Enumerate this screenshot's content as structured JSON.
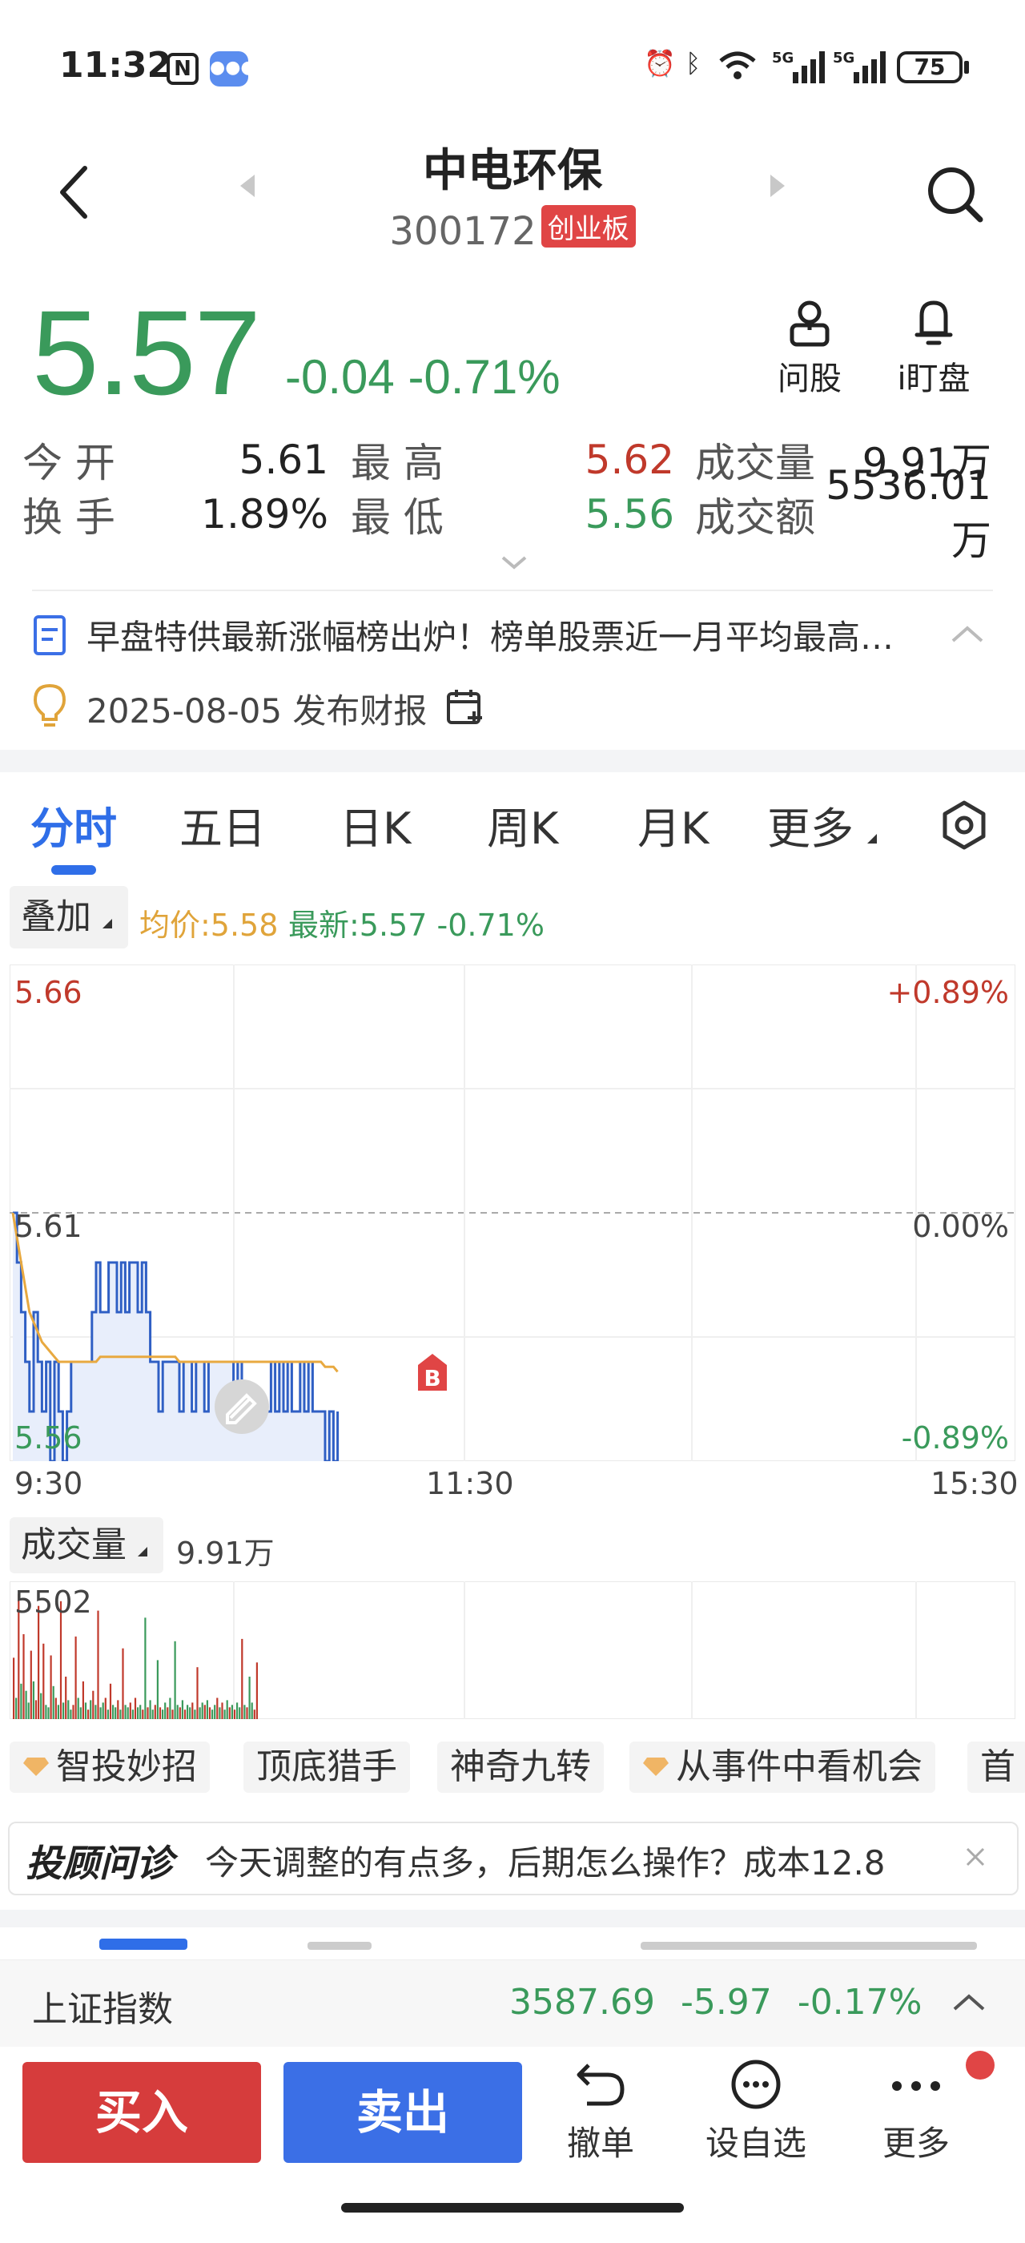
{
  "status_bar": {
    "time": "11:32",
    "nfc": "N",
    "battery": "75"
  },
  "header": {
    "title": "中电环保",
    "code": "300172",
    "board": "创业板"
  },
  "quote": {
    "price": "5.57",
    "change": "-0.04",
    "change_pct": "-0.71%",
    "tools": {
      "ask": "问股",
      "watch": "i盯盘"
    }
  },
  "stats": {
    "row1": [
      {
        "label": "今 开",
        "value": "5.61"
      },
      {
        "label": "最 高",
        "value": "5.62"
      },
      {
        "label": "成交量",
        "value": "9.91万"
      }
    ],
    "row2": [
      {
        "label": "换 手",
        "value": "1.89%"
      },
      {
        "label": "最 低",
        "value": "5.56"
      },
      {
        "label": "成交额",
        "value": "5536.01万"
      }
    ]
  },
  "news": {
    "text": "早盘特供最新涨幅榜出炉！榜单股票近一月平均最高…"
  },
  "event": {
    "text": "2025-08-05 发布财报"
  },
  "tabs": [
    {
      "label": "分时"
    },
    {
      "label": "五日"
    },
    {
      "label": "日K"
    },
    {
      "label": "周K"
    },
    {
      "label": "月K"
    },
    {
      "label": "更多"
    }
  ],
  "overlay": {
    "label": "叠加",
    "avg": "均价:5.58",
    "latest": "最新:5.57 -0.71%"
  },
  "chart_data": {
    "type": "line",
    "title": "",
    "x_ticks": [
      "9:30",
      "11:30",
      "15:30"
    ],
    "y_left_ticks": [
      "5.66",
      "5.61",
      "5.56"
    ],
    "y_right_ticks": [
      "+0.89%",
      "0.00%",
      "-0.89%"
    ],
    "ylim": [
      5.56,
      5.66
    ],
    "prev_close": 5.61,
    "series": [
      {
        "name": "最新",
        "values": [
          5.61,
          5.6,
          5.59,
          5.58,
          5.57,
          5.59,
          5.58,
          5.57,
          5.58,
          5.56,
          5.58,
          5.57,
          5.56,
          5.57,
          5.58,
          5.58,
          5.58,
          5.58,
          5.58,
          5.59,
          5.6,
          5.59,
          5.59,
          5.6,
          5.6,
          5.59,
          5.6,
          5.59,
          5.6,
          5.6,
          5.59,
          5.6,
          5.59,
          5.58,
          5.58,
          5.57,
          5.58,
          5.58,
          5.58,
          5.58,
          5.57,
          5.58,
          5.58,
          5.57,
          5.58,
          5.58,
          5.57,
          5.58,
          5.58,
          5.58,
          5.58,
          5.58,
          5.58,
          5.57,
          5.58,
          5.57,
          5.57,
          5.57,
          5.57,
          5.57,
          5.57,
          5.57,
          5.58,
          5.57,
          5.58,
          5.57,
          5.58,
          5.57,
          5.57,
          5.58,
          5.57,
          5.58,
          5.57,
          5.57,
          5.57,
          5.56,
          5.57,
          5.56,
          5.57
        ]
      },
      {
        "name": "均价",
        "values": [
          5.61,
          5.605,
          5.6,
          5.595,
          5.59,
          5.588,
          5.586,
          5.584,
          5.583,
          5.582,
          5.581,
          5.58,
          5.58,
          5.58,
          5.58,
          5.58,
          5.58,
          5.58,
          5.58,
          5.58,
          5.58,
          5.581,
          5.581,
          5.581,
          5.581,
          5.581,
          5.581,
          5.581,
          5.581,
          5.581,
          5.581,
          5.581,
          5.581,
          5.581,
          5.581,
          5.581,
          5.581,
          5.581,
          5.581,
          5.581,
          5.58,
          5.58,
          5.58,
          5.58,
          5.58,
          5.58,
          5.58,
          5.58,
          5.58,
          5.58,
          5.58,
          5.58,
          5.58,
          5.58,
          5.58,
          5.58,
          5.58,
          5.58,
          5.58,
          5.58,
          5.58,
          5.58,
          5.58,
          5.58,
          5.58,
          5.58,
          5.58,
          5.58,
          5.58,
          5.58,
          5.58,
          5.58,
          5.58,
          5.58,
          5.58,
          5.579,
          5.579,
          5.579,
          5.578
        ]
      }
    ],
    "total_points": 241
  },
  "volume": {
    "label": "成交量",
    "total": "9.91万",
    "max_label": "5502",
    "max": 5502,
    "values": [
      2600,
      900,
      5300,
      1500,
      3600,
      1200,
      700,
      2900,
      1600,
      800,
      4800,
      1100,
      3200,
      600,
      500,
      2700,
      1400,
      900,
      600,
      5000,
      700,
      1800,
      800,
      400,
      600,
      3500,
      900,
      500,
      1600,
      700,
      400,
      800,
      1200,
      600,
      4600,
      500,
      700,
      900,
      400,
      1500,
      600,
      500,
      800,
      400,
      3000,
      600,
      500,
      700,
      400,
      900,
      500,
      600,
      400,
      4300,
      500,
      800,
      400,
      600,
      2500,
      500,
      400,
      700,
      500,
      900,
      400,
      3300,
      600,
      500,
      800,
      400,
      600,
      500,
      700,
      400,
      2200,
      500,
      700,
      600,
      800,
      500,
      400,
      600,
      900,
      500,
      700,
      400,
      800,
      500,
      600,
      400,
      700,
      500,
      3400,
      600,
      500,
      1800,
      700,
      400,
      2400
    ],
    "up_flags": [
      1,
      0,
      1,
      0,
      1,
      0,
      0,
      1,
      0,
      1,
      1,
      0,
      1,
      0,
      0,
      1,
      0,
      1,
      0,
      1,
      0,
      1,
      0,
      0,
      1,
      1,
      0,
      0,
      1,
      0,
      1,
      0,
      1,
      0,
      1,
      0,
      0,
      1,
      0,
      1,
      0,
      0,
      1,
      0,
      1,
      0,
      0,
      1,
      0,
      1,
      0,
      0,
      1,
      0,
      1,
      0,
      0,
      1,
      0,
      1,
      0,
      0,
      1,
      0,
      1,
      0,
      0,
      1,
      0,
      1,
      0,
      0,
      1,
      0,
      1,
      0,
      0,
      1,
      0,
      1,
      0,
      0,
      1,
      0,
      1,
      0,
      0,
      1,
      0,
      1,
      0,
      0,
      1,
      0,
      1,
      0,
      0,
      1,
      1,
      0
    ]
  },
  "chips": [
    {
      "label": "智投妙招",
      "gem": true
    },
    {
      "label": "顶底猎手",
      "gem": false
    },
    {
      "label": "神奇九转",
      "gem": false
    },
    {
      "label": "从事件中看机会",
      "gem": true
    },
    {
      "label": "首",
      "gem": false
    }
  ],
  "advisor": {
    "brand": "投顾问诊",
    "text": "今天调整的有点多，后期怎么操作？成本12.8"
  },
  "index_bar": {
    "name": "上证指数",
    "value": "3587.69",
    "change": "-5.97",
    "change_pct": "-0.17%"
  },
  "bottom_bar": {
    "buy": "买入",
    "sell": "卖出",
    "cancel": "撤单",
    "watchlist": "设自选",
    "more": "更多"
  },
  "marker": "B"
}
